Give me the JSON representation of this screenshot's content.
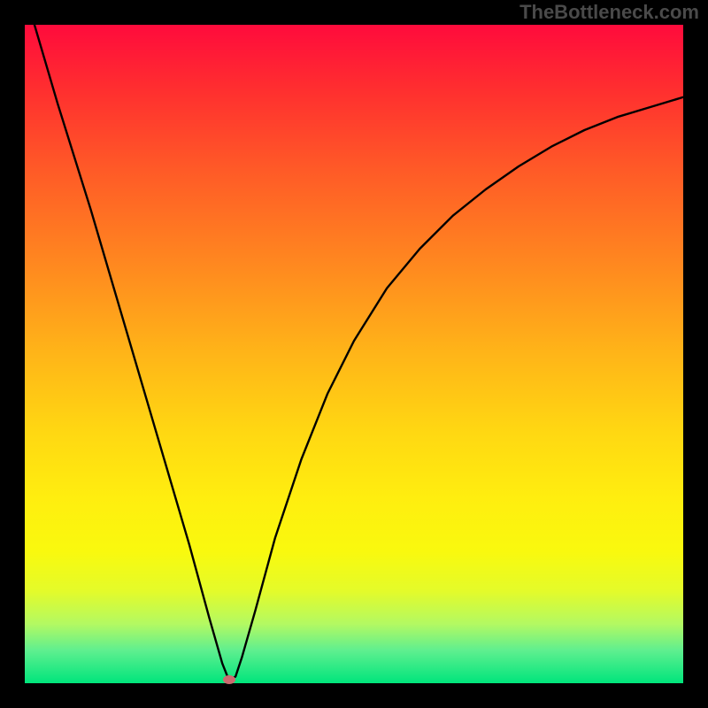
{
  "watermark": "TheBottleneck.com",
  "chart_data": {
    "type": "line",
    "title": "",
    "xlabel": "",
    "ylabel": "",
    "xlim": [
      0,
      100
    ],
    "ylim": [
      0,
      100
    ],
    "grid": false,
    "legend": false,
    "series": [
      {
        "name": "bottleneck-curve",
        "x": [
          0,
          5,
          10,
          15,
          20,
          25,
          28,
          30,
          31,
          32,
          33,
          35,
          38,
          42,
          46,
          50,
          55,
          60,
          65,
          70,
          75,
          80,
          85,
          90,
          95,
          100
        ],
        "values": [
          105,
          88,
          72,
          55,
          38,
          21,
          10,
          3,
          0.5,
          1,
          4,
          11,
          22,
          34,
          44,
          52,
          60,
          66,
          71,
          75,
          78.5,
          81.5,
          84,
          86,
          87.5,
          89
        ]
      }
    ],
    "markers": [
      {
        "name": "minimum-marker",
        "x": 31,
        "y": 0.5,
        "color": "#cc6a6f"
      }
    ],
    "gradient_stops": [
      {
        "pct": 0,
        "color": "#ff0b3c"
      },
      {
        "pct": 10,
        "color": "#ff2f2f"
      },
      {
        "pct": 22,
        "color": "#ff5a27"
      },
      {
        "pct": 37,
        "color": "#ff8a1f"
      },
      {
        "pct": 50,
        "color": "#ffb518"
      },
      {
        "pct": 62,
        "color": "#ffd812"
      },
      {
        "pct": 72,
        "color": "#ffee0f"
      },
      {
        "pct": 80,
        "color": "#f9f90e"
      },
      {
        "pct": 86,
        "color": "#e4fb2a"
      },
      {
        "pct": 91,
        "color": "#b3f962"
      },
      {
        "pct": 95,
        "color": "#5fef8f"
      },
      {
        "pct": 100,
        "color": "#00e57c"
      }
    ]
  }
}
